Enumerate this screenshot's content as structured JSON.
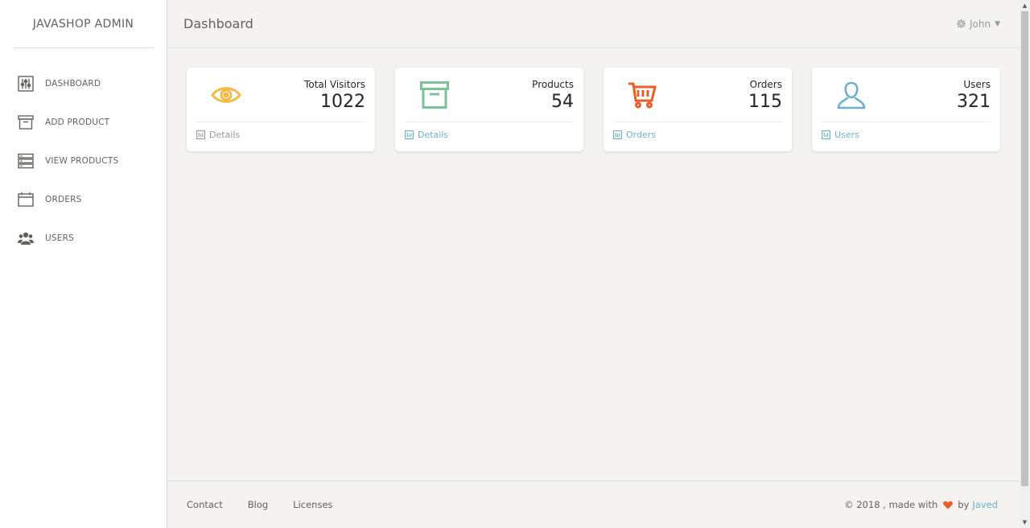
{
  "app": {
    "title": "JAVASHOP ADMIN"
  },
  "sidebar": {
    "items": [
      {
        "label": "DASHBOARD",
        "icon": "sliders-icon"
      },
      {
        "label": "ADD PRODUCT",
        "icon": "archive-icon"
      },
      {
        "label": "VIEW PRODUCTS",
        "icon": "server-list-icon"
      },
      {
        "label": "ORDERS",
        "icon": "calendar-icon"
      },
      {
        "label": "USERS",
        "icon": "users-icon"
      }
    ]
  },
  "header": {
    "title": "Dashboard",
    "user": "John",
    "user_icon": "gear-icon"
  },
  "cards": [
    {
      "label": "Total Visitors",
      "value": "1022",
      "link": "Details",
      "icon": "eye-icon",
      "color": "#f3bb45",
      "link_color": "#9a9a9a"
    },
    {
      "label": "Products",
      "value": "54",
      "link": "Details",
      "icon": "box-icon",
      "color": "#7ac29a",
      "link_color": "#68b3c8"
    },
    {
      "label": "Orders",
      "value": "115",
      "link": "Orders",
      "icon": "cart-icon",
      "color": "#eb5e28",
      "link_color": "#68b3c8"
    },
    {
      "label": "Users",
      "value": "321",
      "link": "Users",
      "icon": "user-icon",
      "color": "#68b3c8",
      "link_color": "#68b3c8"
    }
  ],
  "footer": {
    "links": [
      "Contact",
      "Blog",
      "Licenses"
    ],
    "copyright": "© 2018 , made with",
    "by": "by",
    "author": "Javed",
    "heart_color": "#eb5e28"
  }
}
